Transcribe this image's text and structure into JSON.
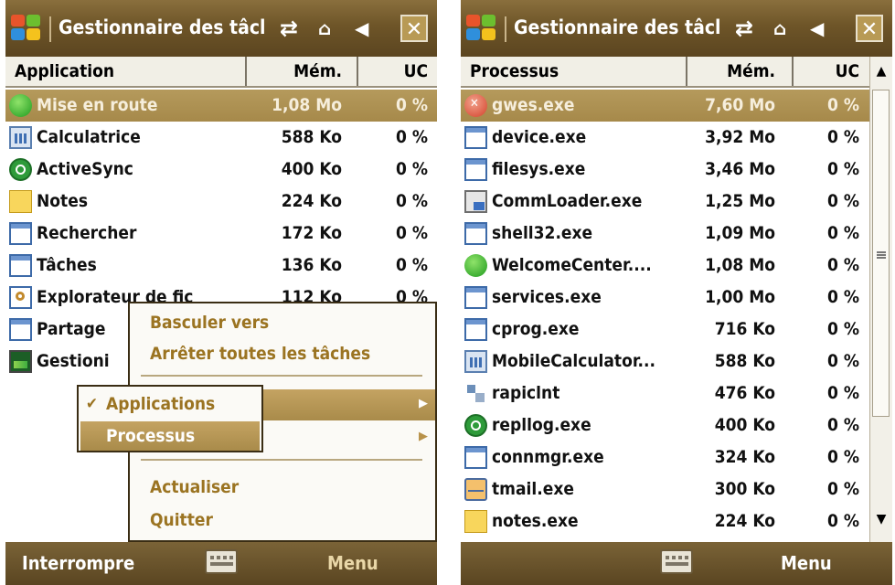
{
  "left_screen": {
    "title": "Gestionnaire des tâcl",
    "columns": {
      "name": "Application",
      "mem": "Mém.",
      "cpu": "UC"
    },
    "rows": [
      {
        "name": "Mise en route",
        "mem": "1,08 Mo",
        "cpu": "0 %",
        "icon": "green-orb-icon",
        "selected": true
      },
      {
        "name": "Calculatrice",
        "mem": "588 Ko",
        "cpu": "0 %",
        "icon": "calculator-icon"
      },
      {
        "name": "ActiveSync",
        "mem": "400 Ko",
        "cpu": "0 %",
        "icon": "sync-icon"
      },
      {
        "name": "Notes",
        "mem": "224 Ko",
        "cpu": "0 %",
        "icon": "note-icon"
      },
      {
        "name": "Rechercher",
        "mem": "172 Ko",
        "cpu": "0 %",
        "icon": "window-icon"
      },
      {
        "name": "Tâches",
        "mem": "136 Ko",
        "cpu": "0 %",
        "icon": "window-icon"
      },
      {
        "name": "Explorateur de fic",
        "mem": "112 Ko",
        "cpu": "0 %",
        "icon": "search-folder-icon"
      },
      {
        "name": "Partage",
        "mem": "",
        "cpu": "",
        "icon": "window-icon"
      },
      {
        "name": "Gestioni",
        "mem": "",
        "cpu": "",
        "icon": "task-manager-icon"
      }
    ],
    "menu": {
      "switch_to": "Basculer vers",
      "stop_all": "Arrêter toutes les tâches",
      "refresh": "Actualiser",
      "quit": "Quitter"
    },
    "submenu": {
      "applications": "Applications",
      "processes": "Processus",
      "check_mark": "✔"
    },
    "softkeys": {
      "left": "Interrompre",
      "right": "Menu"
    }
  },
  "right_screen": {
    "title": "Gestionnaire des tâcl",
    "columns": {
      "name": "Processus",
      "mem": "Mém.",
      "cpu": "UC"
    },
    "rows": [
      {
        "name": "gwes.exe",
        "mem": "7,60 Mo",
        "cpu": "0 %",
        "icon": "error-icon",
        "selected": true
      },
      {
        "name": "device.exe",
        "mem": "3,92 Mo",
        "cpu": "0 %",
        "icon": "window-icon"
      },
      {
        "name": "filesys.exe",
        "mem": "3,46 Mo",
        "cpu": "0 %",
        "icon": "window-icon"
      },
      {
        "name": "CommLoader.exe",
        "mem": "1,25 Mo",
        "cpu": "0 %",
        "icon": "comm-icon"
      },
      {
        "name": "shell32.exe",
        "mem": "1,09 Mo",
        "cpu": "0 %",
        "icon": "window-icon"
      },
      {
        "name": "WelcomeCenter....",
        "mem": "1,08 Mo",
        "cpu": "0 %",
        "icon": "green-orb-icon"
      },
      {
        "name": "services.exe",
        "mem": "1,00 Mo",
        "cpu": "0 %",
        "icon": "window-icon"
      },
      {
        "name": "cprog.exe",
        "mem": "716 Ko",
        "cpu": "0 %",
        "icon": "window-icon"
      },
      {
        "name": "MobileCalculator...",
        "mem": "588 Ko",
        "cpu": "0 %",
        "icon": "calculator-icon"
      },
      {
        "name": "rapiclnt",
        "mem": "476 Ko",
        "cpu": "0 %",
        "icon": "rapi-icon"
      },
      {
        "name": "repllog.exe",
        "mem": "400 Ko",
        "cpu": "0 %",
        "icon": "sync-icon"
      },
      {
        "name": "connmgr.exe",
        "mem": "324 Ko",
        "cpu": "0 %",
        "icon": "window-icon"
      },
      {
        "name": "tmail.exe",
        "mem": "300 Ko",
        "cpu": "0 %",
        "icon": "mail-icon"
      },
      {
        "name": "notes.exe",
        "mem": "224 Ko",
        "cpu": "0 %",
        "icon": "note-icon"
      }
    ],
    "softkeys": {
      "left": "",
      "right": "Menu"
    }
  },
  "status_icons": {
    "network": "⇄",
    "sync": "⌂",
    "volume": "◀"
  },
  "colors": {
    "accent": "#a6894a",
    "menu_text": "#9b7422",
    "titlebar": "#6e5528"
  }
}
